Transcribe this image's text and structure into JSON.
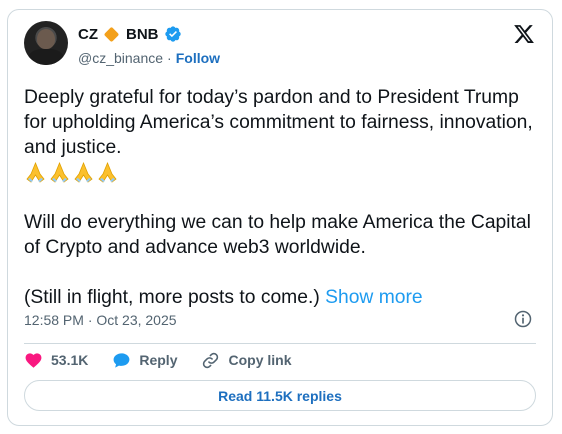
{
  "author": {
    "display_name": "CZ",
    "affiliation": "BNB",
    "handle": "@cz_binance",
    "separator": "·",
    "follow_label": "Follow"
  },
  "tweet": {
    "paragraph1": "Deeply grateful for today’s pardon and to President Trump for upholding America’s commitment to fairness, innovation, and justice.",
    "emoji_count": 4,
    "emoji_icon": "folded-hands-icon",
    "paragraph2": "Will do everything we can to help make America the Capital of Crypto and advance web3 worldwide.",
    "paragraph3": "(Still in flight, more posts to come.)",
    "show_more_label": "Show more"
  },
  "meta": {
    "timestamp": "12:58 PM · Oct 23, 2025"
  },
  "actions": {
    "like_count": "53.1K",
    "reply_label": "Reply",
    "copy_link_label": "Copy link"
  },
  "read_replies_label": "Read 11.5K replies",
  "colors": {
    "accent": "#1d9bf0",
    "link": "#1d6fbf",
    "like": "#f91880",
    "diamond": "#f3a01b",
    "muted": "#536471",
    "border": "#cfd9de"
  }
}
